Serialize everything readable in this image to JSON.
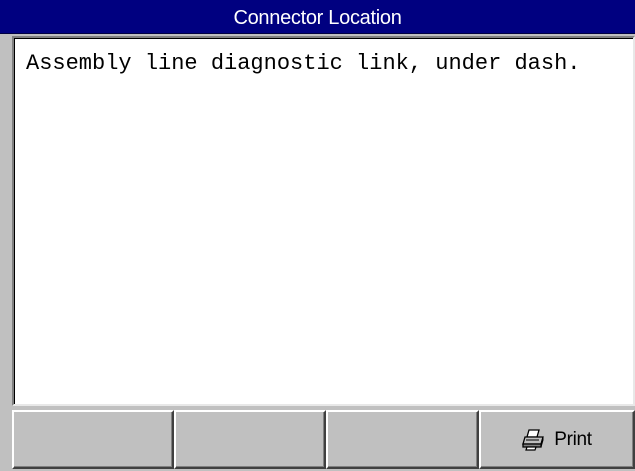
{
  "window": {
    "title": "Connector Location"
  },
  "content": {
    "text": "Assembly line diagnostic link, under dash."
  },
  "buttons": [
    {
      "label": "",
      "icon": ""
    },
    {
      "label": "",
      "icon": ""
    },
    {
      "label": "",
      "icon": ""
    },
    {
      "label": "Print",
      "icon": "printer-icon"
    }
  ],
  "colors": {
    "titlebar": "#000080",
    "title_text": "#ffffff",
    "chrome": "#c0c0c0",
    "content_bg": "#ffffff"
  }
}
